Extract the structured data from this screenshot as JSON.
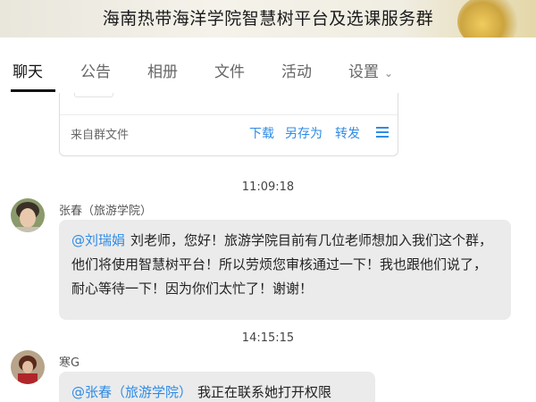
{
  "window": {
    "title": "海南热带海洋学院智慧树平台及选课服务群"
  },
  "tabs": [
    {
      "label": "聊天",
      "active": true
    },
    {
      "label": "公告"
    },
    {
      "label": "相册"
    },
    {
      "label": "文件"
    },
    {
      "label": "活动"
    },
    {
      "label": "设置"
    }
  ],
  "file_card": {
    "source": "来自群文件",
    "download": "下载",
    "save_as": "另存为",
    "forward": "转发"
  },
  "messages": [
    {
      "time": "11:09:18",
      "sender": "张春（旅游学院）",
      "mention": "@刘瑞娟",
      "text": "刘老师，您好！旅游学院目前有几位老师想加入我们这个群，他们将使用智慧树平台！所以劳烦您审核通过一下！我也跟他们说了，耐心等待一下！因为你们太忙了！谢谢！"
    },
    {
      "time": "14:15:15",
      "sender": "寒G",
      "mention": "@张春（旅游学院）",
      "text": "我正在联系她打开权限"
    }
  ],
  "colors": {
    "link": "#2e8be6",
    "bubble": "#ebebeb"
  }
}
